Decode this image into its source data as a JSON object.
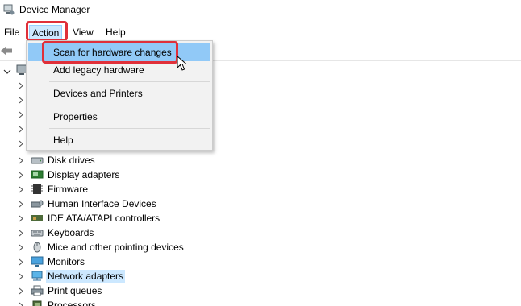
{
  "window": {
    "title": "Device Manager",
    "icon": "device-manager-icon"
  },
  "menubar": {
    "items": [
      "File",
      "Action",
      "View",
      "Help"
    ],
    "active": "Action"
  },
  "toolbar": {
    "back_icon": "back-arrow-icon"
  },
  "tree": {
    "root_icon": "computer-icon",
    "rows": [
      {
        "label": "Disk drives",
        "icon": "disk-drive-icon"
      },
      {
        "label": "Display adapters",
        "icon": "display-adapter-icon"
      },
      {
        "label": "Firmware",
        "icon": "firmware-icon"
      },
      {
        "label": "Human Interface Devices",
        "icon": "hid-icon"
      },
      {
        "label": "IDE ATA/ATAPI controllers",
        "icon": "ide-controller-icon"
      },
      {
        "label": "Keyboards",
        "icon": "keyboard-icon"
      },
      {
        "label": "Mice and other pointing devices",
        "icon": "mouse-icon"
      },
      {
        "label": "Monitors",
        "icon": "monitor-icon"
      },
      {
        "label": "Network adapters",
        "icon": "network-adapter-icon",
        "selected": true
      },
      {
        "label": "Print queues",
        "icon": "printer-icon"
      },
      {
        "label": "Processors",
        "icon": "processor-icon"
      }
    ]
  },
  "action_menu": {
    "items": [
      {
        "label": "Scan for hardware changes",
        "hover": true
      },
      {
        "label": "Add legacy hardware"
      },
      {
        "label": "Devices and Printers"
      },
      {
        "label": "Properties"
      },
      {
        "label": "Help"
      }
    ]
  },
  "colors": {
    "highlight": "#e0303a",
    "selection": "#cce8ff",
    "menu_hover": "#91c9f7"
  }
}
